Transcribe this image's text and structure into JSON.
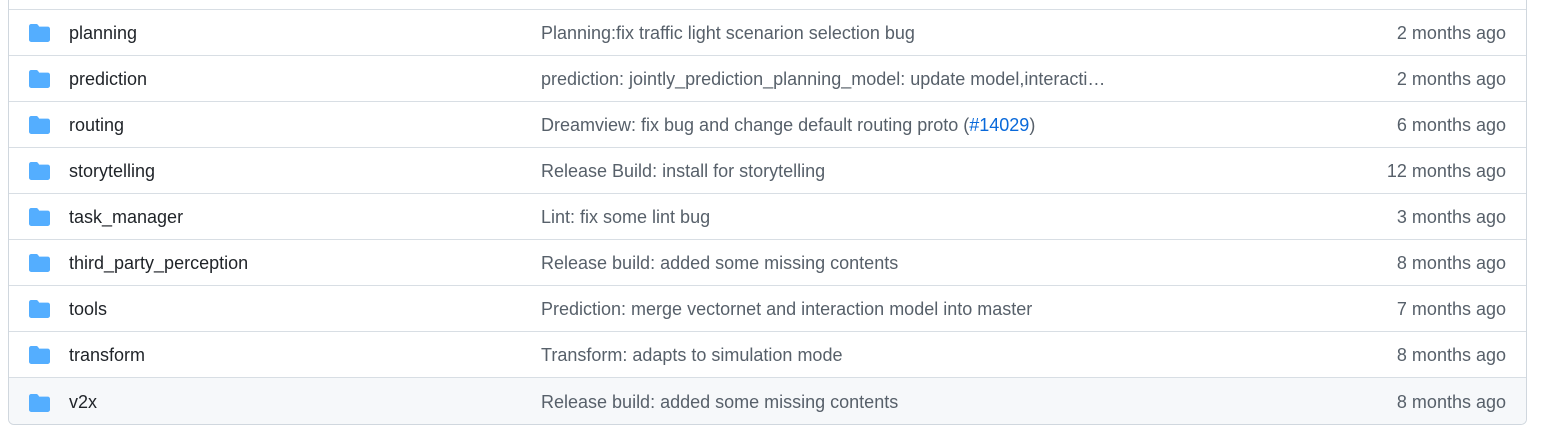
{
  "colors": {
    "folder_icon": "#54aeff",
    "text_primary": "#1f2328",
    "text_muted": "#57606a",
    "link": "#0969da",
    "border": "#d0d7de",
    "hover_row": "#f6f8fa"
  },
  "rows": [
    {
      "icon": "folder-icon",
      "name": "planning",
      "commit_message": "Planning:fix traffic light scenarion selection bug",
      "commit_link": "",
      "commit_suffix": "",
      "age": "2 months ago"
    },
    {
      "icon": "folder-icon",
      "name": "prediction",
      "commit_message": "prediction: jointly_prediction_planning_model: update model,interacti…",
      "commit_link": "",
      "commit_suffix": "",
      "age": "2 months ago"
    },
    {
      "icon": "folder-icon",
      "name": "routing",
      "commit_message": "Dreamview: fix bug and change default routing proto (",
      "commit_link": "#14029",
      "commit_suffix": ")",
      "age": "6 months ago"
    },
    {
      "icon": "folder-icon",
      "name": "storytelling",
      "commit_message": "Release Build: install for storytelling",
      "commit_link": "",
      "commit_suffix": "",
      "age": "12 months ago"
    },
    {
      "icon": "folder-icon",
      "name": "task_manager",
      "commit_message": "Lint: fix some lint bug",
      "commit_link": "",
      "commit_suffix": "",
      "age": "3 months ago"
    },
    {
      "icon": "folder-icon",
      "name": "third_party_perception",
      "commit_message": "Release build: added some missing contents",
      "commit_link": "",
      "commit_suffix": "",
      "age": "8 months ago"
    },
    {
      "icon": "folder-icon",
      "name": "tools",
      "commit_message": "Prediction: merge vectornet and interaction model into master",
      "commit_link": "",
      "commit_suffix": "",
      "age": "7 months ago"
    },
    {
      "icon": "folder-icon",
      "name": "transform",
      "commit_message": "Transform: adapts to simulation mode",
      "commit_link": "",
      "commit_suffix": "",
      "age": "8 months ago"
    },
    {
      "icon": "folder-icon",
      "name": "v2x",
      "commit_message": "Release build: added some missing contents",
      "commit_link": "",
      "commit_suffix": "",
      "age": "8 months ago"
    }
  ]
}
